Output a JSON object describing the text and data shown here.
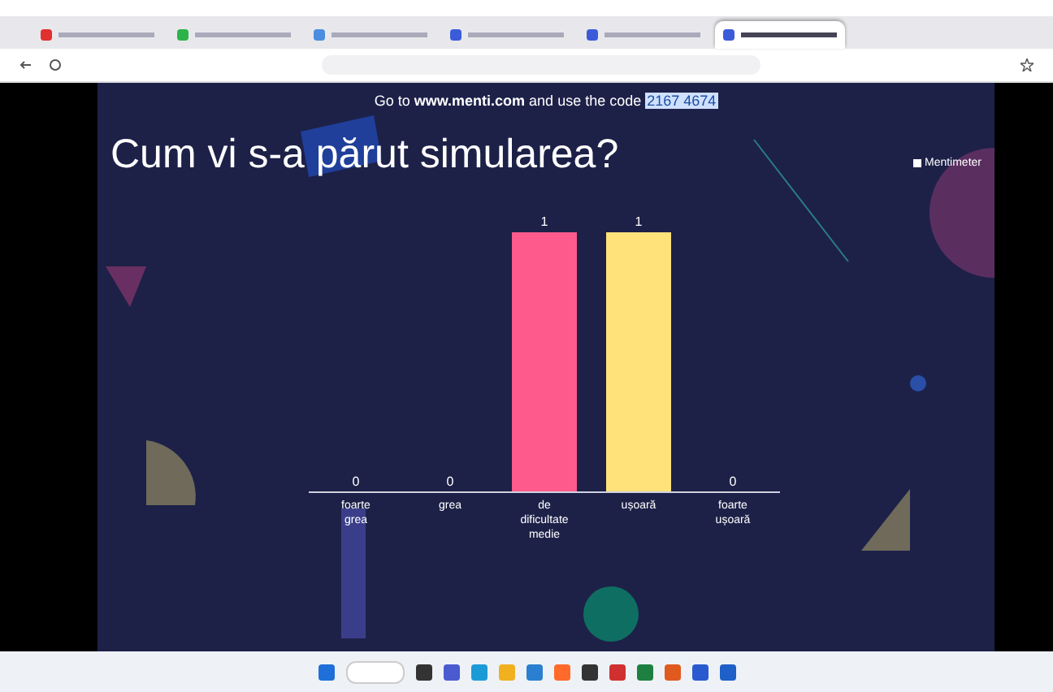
{
  "browser": {
    "tabs": [
      {
        "selected": false
      },
      {
        "selected": false
      },
      {
        "selected": false
      },
      {
        "selected": false
      },
      {
        "selected": false
      },
      {
        "selected": true
      }
    ]
  },
  "slide": {
    "join_prefix": "Go to ",
    "join_site": "www.menti.com",
    "join_middle": " and use the code ",
    "join_code": "2167 4674",
    "title": "Cum vi s-a părut simularea?",
    "brand": "Mentimeter",
    "chart_data": {
      "type": "bar",
      "categories": [
        "foarte grea",
        "grea",
        "de dificultate medie",
        "ușoară",
        "foarte ușoară"
      ],
      "values": [
        0,
        0,
        1,
        1,
        0
      ],
      "value_labels": [
        "0",
        "0",
        "1",
        "1",
        "0"
      ],
      "colors": [
        "#ff5a8c",
        "#ff5a8c",
        "#ff5a8c",
        "#ffe27a",
        "#ffe27a"
      ],
      "data_labels": true
    }
  }
}
